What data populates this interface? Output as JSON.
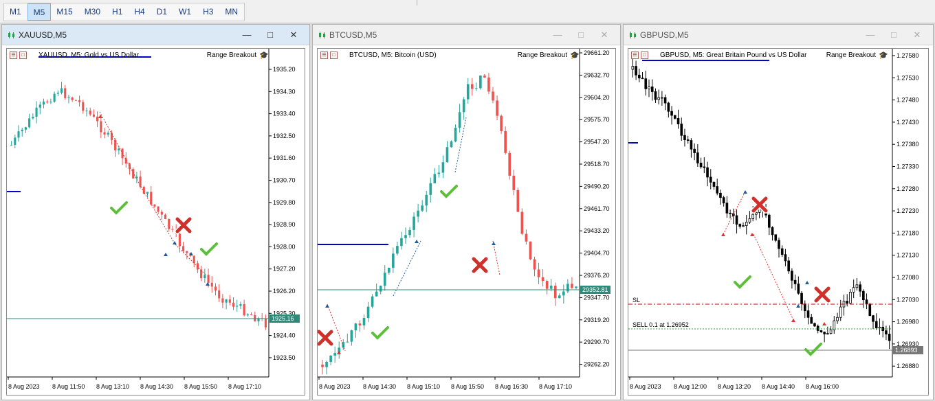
{
  "toolbar": {
    "timeframes": [
      "M1",
      "M5",
      "M15",
      "M30",
      "H1",
      "H4",
      "D1",
      "W1",
      "H3",
      "MN"
    ],
    "active": "M5"
  },
  "windows": [
    {
      "title": "XAUUSD,M5",
      "symbol_desc": "XAUUSD, M5:  Gold vs US Dollar",
      "ea": "Range Breakout",
      "prices": [
        "1935.20",
        "1934.30",
        "1933.40",
        "1932.50",
        "1931.60",
        "1930.70",
        "1929.80",
        "1928.90",
        "1928.00",
        "1927.20",
        "1926.20",
        "1925.30",
        "1924.40",
        "1923.50"
      ],
      "current_price": "1925.16",
      "times": [
        "8 Aug 2023",
        "8 Aug 11:50",
        "8 Aug 13:10",
        "8 Aug 14:30",
        "8 Aug 15:50",
        "8 Aug 17:10"
      ],
      "active": true
    },
    {
      "title": "BTCUSD,M5",
      "symbol_desc": "BTCUSD, M5:  Bitcoin (USD)",
      "ea": "Range Breakout",
      "prices": [
        "29661.20",
        "29632.70",
        "29604.20",
        "29575.70",
        "29547.20",
        "29518.70",
        "29490.20",
        "29461.70",
        "29433.20",
        "29404.70",
        "29376.20",
        "29347.70",
        "29319.20",
        "29290.70",
        "29262.20"
      ],
      "current_price": "29352.81",
      "times": [
        "8 Aug 2023",
        "8 Aug 14:30",
        "8 Aug 15:10",
        "8 Aug 15:50",
        "8 Aug 16:30",
        "8 Aug 17:10"
      ],
      "active": false
    },
    {
      "title": "GBPUSD,M5",
      "symbol_desc": "GBPUSD, M5:  Great Britain Pound vs US Dollar",
      "ea": "Range Breakout",
      "prices": [
        "1.27580",
        "1.27530",
        "1.27480",
        "1.27430",
        "1.27380",
        "1.27330",
        "1.27280",
        "1.27230",
        "1.27180",
        "1.27130",
        "1.27080",
        "1.27030",
        "1.26980",
        "1.26930",
        "1.26880"
      ],
      "current_price": "1.26893",
      "sl_label": "SL",
      "sell_label": "SELL 0.1 at 1.26952",
      "times": [
        "8 Aug 2023",
        "8 Aug 12:00",
        "8 Aug 13:20",
        "8 Aug 14:40",
        "8 Aug 16:00"
      ],
      "active": false
    }
  ],
  "colors": {
    "bull": "#26a69a",
    "bear": "#ef5350",
    "range_line": "#0000cc",
    "price_line": "#2e8b7a",
    "sl_line": "#cc0000",
    "entry_line": "#22aa22"
  }
}
